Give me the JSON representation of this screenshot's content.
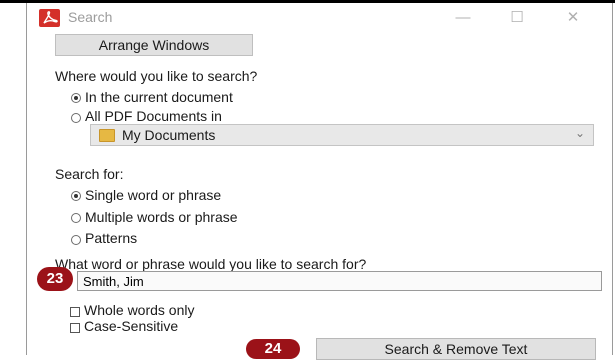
{
  "window": {
    "title": "Search",
    "minimize_glyph": "—",
    "maximize_glyph": "☐",
    "close_glyph": "✕"
  },
  "toolbar": {
    "arrange_label": "Arrange Windows"
  },
  "location": {
    "question": "Where would you like to search?",
    "option_current": "In the current document",
    "option_all": "All PDF Documents in",
    "selected": "In the current document",
    "folder_value": "My Documents"
  },
  "search_for": {
    "label": "Search for:",
    "option_single": "Single word or phrase",
    "option_multiple": "Multiple words or phrase",
    "option_patterns": "Patterns",
    "selected": "Single word or phrase"
  },
  "query": {
    "question": "What word or phrase would you like to search for?",
    "value": "Smith, Jim"
  },
  "options": {
    "whole_words": "Whole words only",
    "case_sensitive": "Case-Sensitive"
  },
  "action": {
    "button_label": "Search & Remove Text"
  },
  "annotations": {
    "step_input": "23",
    "step_button": "24"
  },
  "colors": {
    "badge": "#9b1218",
    "app_icon": "#d4302a"
  },
  "icons": [
    "acrobat-logo-icon",
    "folder-icon",
    "chevron-down-icon",
    "minimize-icon",
    "maximize-icon",
    "close-icon"
  ]
}
